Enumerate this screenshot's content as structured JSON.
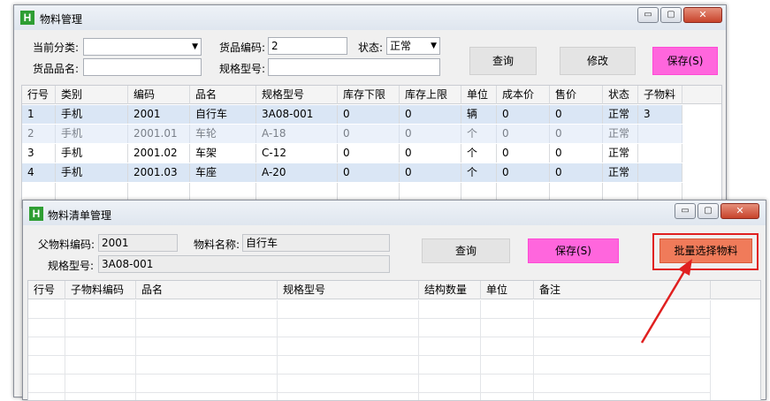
{
  "main_window": {
    "icon_letter": "H",
    "title": "物料管理",
    "controls": {
      "minimize": "▭",
      "maximize": "▢",
      "close": "✕"
    },
    "filters": {
      "category_label": "当前分类:",
      "category_value": "",
      "code_label": "货品编码:",
      "code_value": "2",
      "status_label": "状态:",
      "status_value": "正常",
      "name_label": "货品品名:",
      "name_value": "",
      "spec_label": "规格型号:",
      "spec_value": ""
    },
    "buttons": {
      "query": "查询",
      "modify": "修改",
      "save": "保存(S)"
    },
    "table": {
      "columns": [
        "行号",
        "类别",
        "编码",
        "品名",
        "规格型号",
        "库存下限",
        "库存上限",
        "单位",
        "成本价",
        "售价",
        "状态",
        "子物料"
      ],
      "rows": [
        [
          "1",
          "手机",
          "2001",
          "自行车",
          "3A08-001",
          "0",
          "0",
          "辆",
          "0",
          "0",
          "正常",
          "3"
        ],
        [
          "2",
          "手机",
          "2001.01",
          "车轮",
          "A-18",
          "0",
          "0",
          "个",
          "0",
          "0",
          "正常",
          ""
        ],
        [
          "3",
          "手机",
          "2001.02",
          "车架",
          "C-12",
          "0",
          "0",
          "个",
          "0",
          "0",
          "正常",
          ""
        ],
        [
          "4",
          "手机",
          "2001.03",
          "车座",
          "A-20",
          "0",
          "0",
          "个",
          "0",
          "0",
          "正常",
          ""
        ]
      ]
    }
  },
  "bom_window": {
    "icon_letter": "H",
    "title": "物料清单管理",
    "controls": {
      "minimize": "▭",
      "maximize": "▢",
      "close": "✕"
    },
    "fields": {
      "parent_code_label": "父物料编码:",
      "parent_code_value": "2001",
      "item_name_label": "物料名称:",
      "item_name_value": "自行车",
      "spec_label": "规格型号:",
      "spec_value": "3A08-001"
    },
    "buttons": {
      "query": "查询",
      "save": "保存(S)",
      "batch_select": "批量选择物料"
    },
    "table": {
      "columns": [
        "行号",
        "子物料编码",
        "品名",
        "规格型号",
        "结构数量",
        "单位",
        "备注"
      ]
    }
  },
  "colors": {
    "highlight_row": "#dae6f5",
    "save_button": "#ff66dd",
    "batch_button": "#f07b5a",
    "annotation": "#e02020"
  }
}
